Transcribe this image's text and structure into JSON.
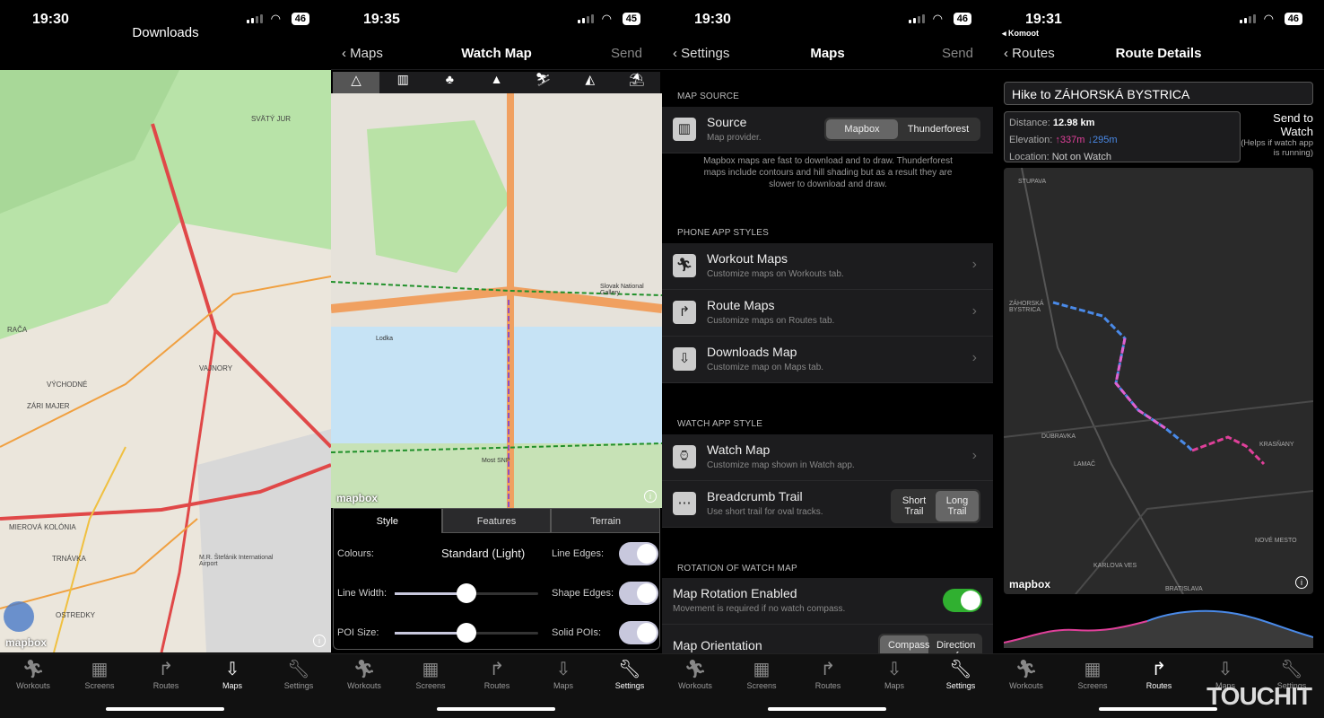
{
  "tabs": [
    "Workouts",
    "Screens",
    "Routes",
    "Maps",
    "Settings"
  ],
  "tab_icons": [
    "running-icon",
    "screens-icon",
    "routes-icon",
    "maps-download-icon",
    "wrench-icon"
  ],
  "p1": {
    "time": "19:30",
    "battery": "46",
    "title": "Downloads",
    "map_labels": [
      "SVÄTÝ JUR",
      "RAČA",
      "VAJNORY",
      "VÝCHODNÉ",
      "ZÁRI MAJER",
      "MIEROVÁ KOLÓNIA",
      "TRNÁVKA",
      "OSTREDKY",
      "M.R. Štefánik International Airport"
    ],
    "map_brand": "mapbox"
  },
  "p2": {
    "time": "19:35",
    "battery": "45",
    "back": "Maps",
    "title": "Watch Map",
    "send": "Send",
    "style_icons": [
      "navigation-icon",
      "city-icon",
      "trees-icon",
      "mountains-icon",
      "ski-icon",
      "snow-mountain-icon",
      "beach-icon"
    ],
    "map_labels": [
      "Lodka",
      "Most SNP",
      "Slovak National Gallery"
    ],
    "map_brand": "mapbox",
    "tabs": [
      "Style",
      "Features",
      "Terrain"
    ],
    "active_tab": "Style",
    "colours_label": "Colours:",
    "colours_value": "Standard (Light)",
    "line_width_label": "Line Width:",
    "line_width": 0.5,
    "poi_size_label": "POI Size:",
    "poi_size": 0.5,
    "line_edges_label": "Line Edges:",
    "line_edges": true,
    "shape_edges_label": "Shape Edges:",
    "shape_edges": true,
    "solid_pois_label": "Solid POIs:",
    "solid_pois": true
  },
  "p3": {
    "time": "19:30",
    "battery": "46",
    "back": "Settings",
    "title": "Maps",
    "send": "Send",
    "map_source_header": "MAP SOURCE",
    "source_title": "Source",
    "source_sub": "Map provider.",
    "source_options": [
      "Mapbox",
      "Thunderforest"
    ],
    "source_selected": "Mapbox",
    "source_note": "Mapbox maps are fast to download and to draw. Thunderforest maps include contours and hill shading but as a result they are slower to download and draw.",
    "phone_header": "PHONE APP STYLES",
    "phone_rows": [
      {
        "title": "Workout Maps",
        "sub": "Customize maps on Workouts tab."
      },
      {
        "title": "Route Maps",
        "sub": "Customize maps on Routes tab."
      },
      {
        "title": "Downloads Map",
        "sub": "Customize map on Maps tab."
      }
    ],
    "watch_header": "WATCH APP STYLE",
    "watch_map_title": "Watch Map",
    "watch_map_sub": "Customize map shown in Watch app.",
    "breadcrumb_title": "Breadcrumb Trail",
    "breadcrumb_sub": "Use short trail for oval tracks.",
    "breadcrumb_options": [
      "Short Trail",
      "Long Trail"
    ],
    "breadcrumb_selected": "Long Trail",
    "rotation_header": "ROTATION OF WATCH MAP",
    "rotation_title": "Map Rotation Enabled",
    "rotation_sub": "Movement is required if no watch compass.",
    "rotation_enabled": true,
    "orientation_title": "Map Orientation",
    "orientation_options": [
      "Compass",
      "Direction of Travel"
    ],
    "orientation_selected": "Compass"
  },
  "p4": {
    "time": "19:31",
    "battery": "46",
    "back_app": "◂ Komoot",
    "back": "Routes",
    "title": "Route Details",
    "route_name": "Hike to ZÁHORSKÁ BYSTRICA",
    "distance_label": "Distance:",
    "distance": "12.98 km",
    "elevation_label": "Elevation:",
    "ascent": "↑337m",
    "descent": "↓295m",
    "location_label": "Location:",
    "location": "Not on Watch",
    "send_title": "Send to Watch",
    "send_note": "(Helps if watch app is running)",
    "map_labels": [
      "STUPAVA",
      "ZÁHORSKÁ BYSTRICA",
      "LAMAČ",
      "DÚBRAVKA",
      "KARLOVA VES",
      "NOVÉ MESTO",
      "BRATISLAVA",
      "KRASŇANY"
    ],
    "map_brand": "mapbox",
    "colors": {
      "ascent": "#e0409a",
      "descent": "#4a8ae8"
    }
  },
  "watermark": "TOUCHIT"
}
